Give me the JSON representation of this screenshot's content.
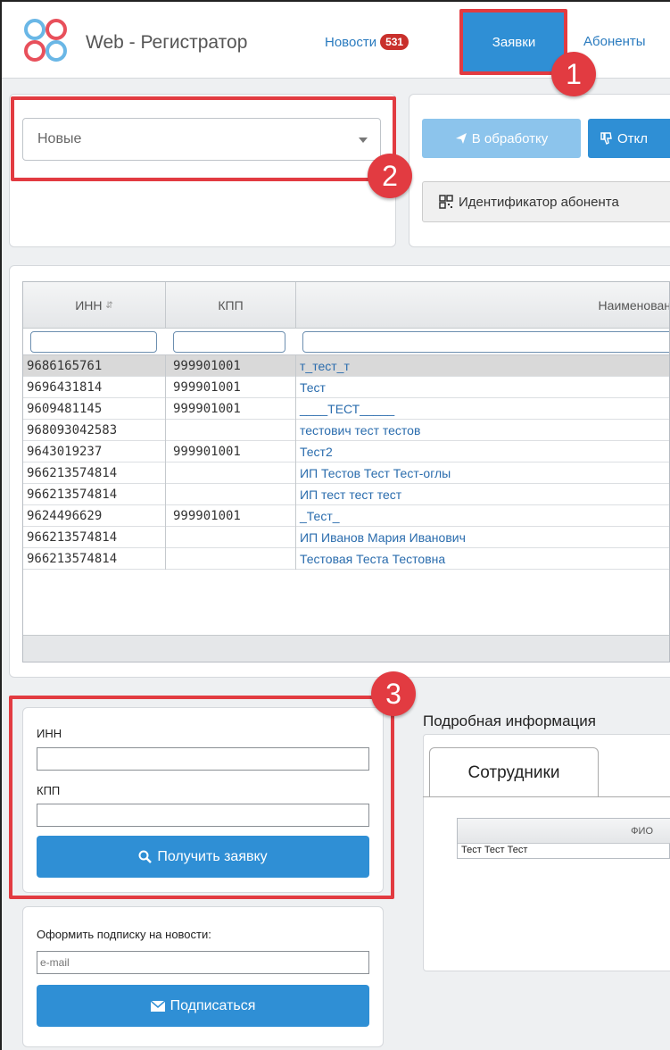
{
  "header": {
    "app_title": "Web - Регистратор",
    "news_label": "Новости",
    "news_count": "531",
    "requests_tab": "Заявки",
    "subscribers_tab": "Абоненты"
  },
  "filter": {
    "status_selected": "Новые"
  },
  "toolbar": {
    "process_label": "В обработку",
    "reject_label": "Откл",
    "identifier_label": "Идентификатор абонента"
  },
  "table": {
    "columns": [
      "ИНН",
      "КПП",
      "Наименован"
    ],
    "rows": [
      {
        "inn": "9686165761",
        "kpp": "999901001",
        "name": "т_тест_т"
      },
      {
        "inn": "9696431814",
        "kpp": "999901001",
        "name": "Тест"
      },
      {
        "inn": "9609481145",
        "kpp": "999901001",
        "name": "____ТЕСТ_____"
      },
      {
        "inn": "968093042583",
        "kpp": "",
        "name": "тестович тест тестов"
      },
      {
        "inn": "9643019237",
        "kpp": "999901001",
        "name": "Тест2"
      },
      {
        "inn": "966213574814",
        "kpp": "",
        "name": "ИП Тестов Тест Тест-оглы"
      },
      {
        "inn": "966213574814",
        "kpp": "",
        "name": "ИП тест тест тест"
      },
      {
        "inn": "9624496629",
        "kpp": "999901001",
        "name": "_Тест_"
      },
      {
        "inn": "966213574814",
        "kpp": "",
        "name": "ИП Иванов Мария Иванович"
      },
      {
        "inn": "966213574814",
        "kpp": "",
        "name": "Тестовая Теста Тестовна"
      }
    ]
  },
  "get_request": {
    "inn_label": "ИНН",
    "kpp_label": "КПП",
    "button_label": "Получить заявку"
  },
  "subscribe": {
    "title": "Оформить подписку на новости:",
    "email_placeholder": "e-mail",
    "button_label": "Подписаться"
  },
  "details": {
    "title": "Подробная информация",
    "tab_label": "Сотрудники",
    "column_fio": "ФИО",
    "row_value": "Тест Тест Тест"
  },
  "annotations": [
    "1",
    "2",
    "3"
  ],
  "colors": {
    "accent": "#2f8fd5",
    "highlight": "#e23b41",
    "badge": "#c9302c"
  }
}
